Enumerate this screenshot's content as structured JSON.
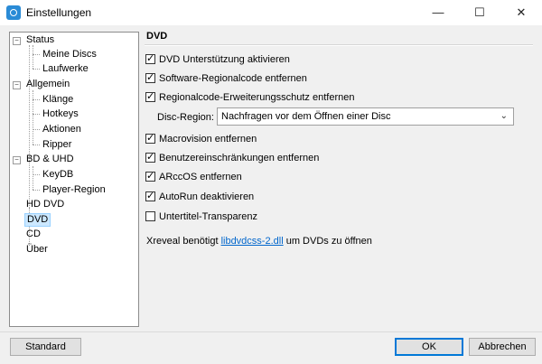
{
  "window": {
    "title": "Einstellungen",
    "controls": {
      "minimize": "—",
      "maximize": "☐",
      "close": "✕"
    }
  },
  "tree": {
    "items": [
      {
        "label": "Status",
        "level": 0,
        "expandable": true
      },
      {
        "label": "Meine Discs",
        "level": 1
      },
      {
        "label": "Laufwerke",
        "level": 1
      },
      {
        "label": "Allgemein",
        "level": 0,
        "expandable": true
      },
      {
        "label": "Klänge",
        "level": 1
      },
      {
        "label": "Hotkeys",
        "level": 1
      },
      {
        "label": "Aktionen",
        "level": 1
      },
      {
        "label": "Ripper",
        "level": 1
      },
      {
        "label": "BD & UHD",
        "level": 0,
        "expandable": true
      },
      {
        "label": "KeyDB",
        "level": 1
      },
      {
        "label": "Player-Region",
        "level": 1
      },
      {
        "label": "HD DVD",
        "level": 0
      },
      {
        "label": "DVD",
        "level": 0,
        "selected": true
      },
      {
        "label": "CD",
        "level": 0
      },
      {
        "label": "Über",
        "level": 0
      }
    ]
  },
  "panel": {
    "title": "DVD",
    "options": [
      {
        "label": "DVD Unterstützung aktivieren",
        "checked": true
      },
      {
        "label": "Software-Regionalcode entfernen",
        "checked": true
      },
      {
        "label": "Regionalcode-Erweiterungsschutz entfernen",
        "checked": true
      },
      {
        "label": "Macrovision entfernen",
        "checked": true
      },
      {
        "label": "Benutzereinschränkungen entfernen",
        "checked": true
      },
      {
        "label": "ARccOS entfernen",
        "checked": true
      },
      {
        "label": "AutoRun deaktivieren",
        "checked": true
      },
      {
        "label": "Untertitel-Transparenz",
        "checked": false
      }
    ],
    "disc_region": {
      "label": "Disc-Region:",
      "value": "Nachfragen vor dem Öffnen einer Disc"
    },
    "note": {
      "before": "Xreveal benötigt ",
      "link": "libdvdcss-2.dll",
      "after": " um DVDs zu öffnen"
    }
  },
  "buttons": {
    "standard": "Standard",
    "ok": "OK",
    "cancel": "Abbrechen"
  },
  "glyphs": {
    "check": "✓",
    "expanded": "−",
    "dropdown": "⌄"
  },
  "colors": {
    "selection": "#cce8ff",
    "link": "#0066cc",
    "default_button_border": "#0078d7"
  }
}
